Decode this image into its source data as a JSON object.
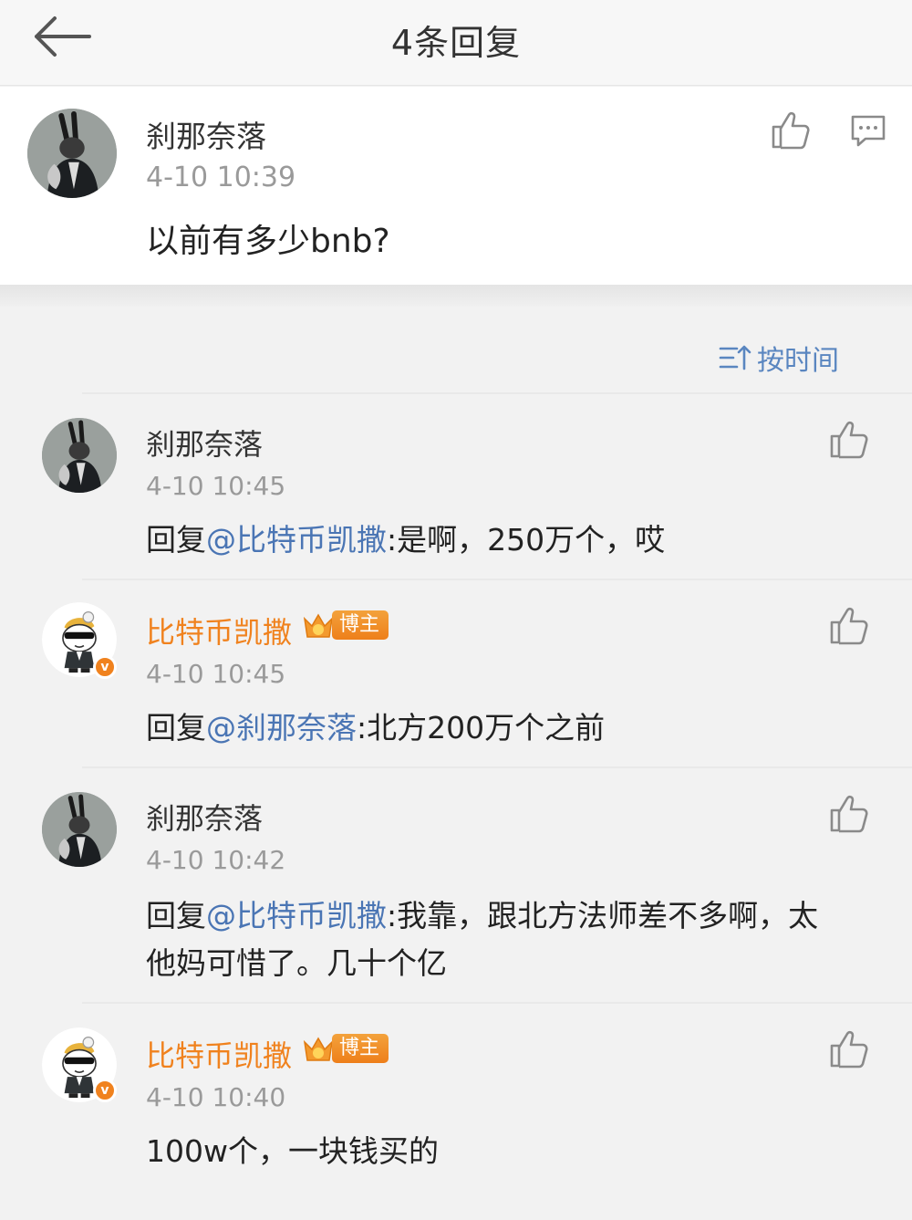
{
  "header": {
    "title": "4条回复"
  },
  "main_comment": {
    "user": "刹那奈落",
    "time": "4-10 10:39",
    "text": "以前有多少bnb?"
  },
  "sort": {
    "label": "按时间"
  },
  "replies": [
    {
      "user": "刹那奈落",
      "time": "4-10 10:45",
      "prefix": "回复",
      "mention": "@比特币凯撒",
      "text": ":是啊，250万个，哎"
    },
    {
      "user": "比特币凯撒",
      "badge": "博主",
      "time": "4-10 10:45",
      "prefix": "回复",
      "mention": "@刹那奈落",
      "text": ":北方200万个之前"
    },
    {
      "user": "刹那奈落",
      "time": "4-10 10:42",
      "prefix": "回复",
      "mention": "@比特币凯撒",
      "text": ":我靠，跟北方法师差不多啊，太",
      "text2": "他妈可惜了。几十个亿"
    },
    {
      "user": "比特币凯撒",
      "badge": "博主",
      "time": "4-10 10:40",
      "text": "100w个，一块钱买的"
    }
  ],
  "colors": {
    "mention": "#4a75b4",
    "blogger_name": "#f0821e",
    "badge": "#f0821e"
  },
  "icons": [
    "back-arrow-icon",
    "thumbs-up-icon",
    "comment-icon",
    "sort-icon",
    "crown-icon",
    "verified-icon"
  ]
}
